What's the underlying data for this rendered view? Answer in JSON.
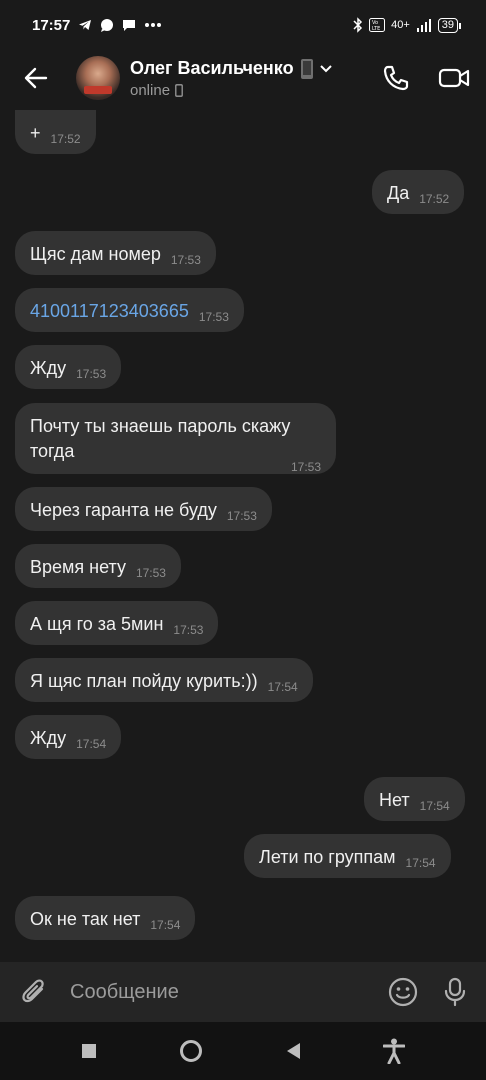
{
  "status_bar": {
    "time": "17:57",
    "network": "40+",
    "battery": "39"
  },
  "header": {
    "contact_name": "Олег Васильченко",
    "status": "online"
  },
  "messages": [
    {
      "side": "in",
      "text": "+",
      "time": "17:52"
    },
    {
      "side": "out",
      "text": "Да",
      "time": "17:52"
    },
    {
      "side": "in",
      "text": "Щяс дам номер",
      "time": "17:53"
    },
    {
      "side": "in",
      "text": "4100117123403665",
      "time": "17:53",
      "link": true
    },
    {
      "side": "in",
      "text": "Жду",
      "time": "17:53"
    },
    {
      "side": "in",
      "text": "Почту ты знаешь пароль скажу тогда",
      "time": "17:53"
    },
    {
      "side": "in",
      "text": "Через гаранта не буду",
      "time": "17:53"
    },
    {
      "side": "in",
      "text": "Время нету",
      "time": "17:53"
    },
    {
      "side": "in",
      "text": "А щя го за 5мин",
      "time": "17:53"
    },
    {
      "side": "in",
      "text": "Я щяс план пойду курить:))",
      "time": "17:54"
    },
    {
      "side": "in",
      "text": "Жду",
      "time": "17:54"
    },
    {
      "side": "out",
      "text": "Нет",
      "time": "17:54"
    },
    {
      "side": "out",
      "text": "Лети по группам",
      "time": "17:54"
    },
    {
      "side": "in",
      "text": "Ок не так нет",
      "time": "17:54"
    }
  ],
  "composer": {
    "placeholder": "Сообщение"
  },
  "icons": {
    "back": "arrow-left-icon",
    "call": "phone-icon",
    "video": "video-camera-icon",
    "attach": "paperclip-icon",
    "emoji": "smiley-icon",
    "mic": "microphone-icon"
  }
}
